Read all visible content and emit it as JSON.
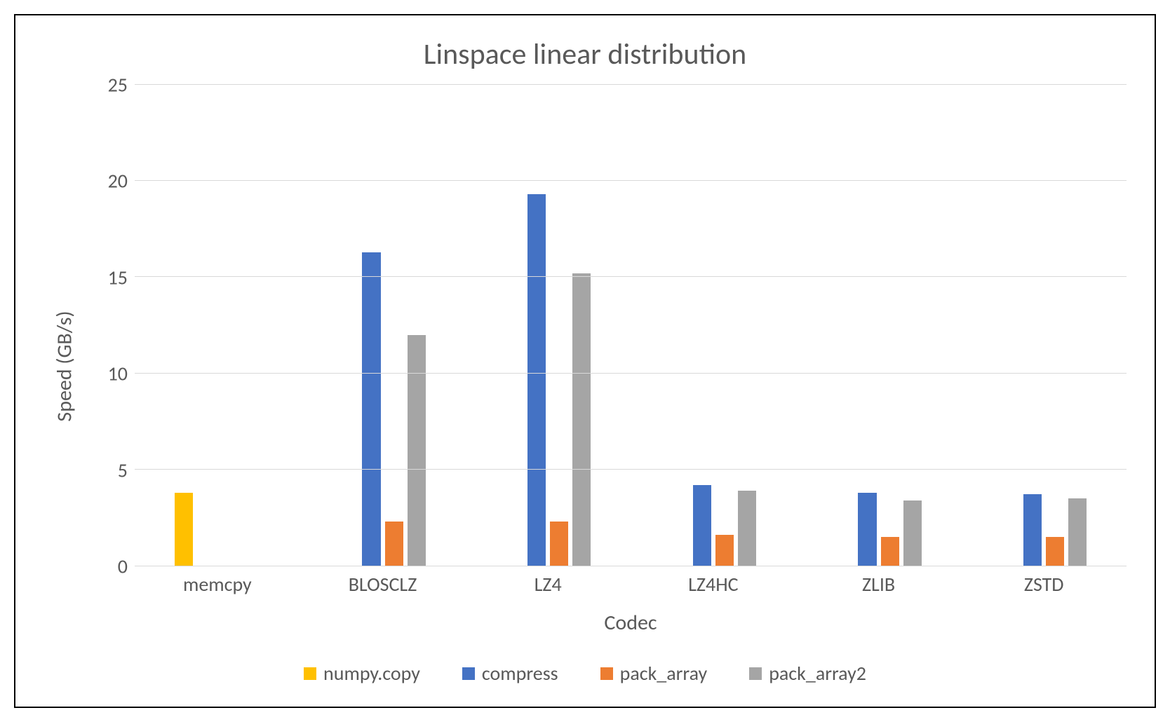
{
  "chart_data": {
    "type": "bar",
    "title": "Linspace linear distribution",
    "xlabel": "Codec",
    "ylabel": "Speed (GB/s)",
    "ylim": [
      0,
      25
    ],
    "yticks": [
      0,
      5,
      10,
      15,
      20,
      25
    ],
    "categories": [
      "memcpy",
      "BLOSCLZ",
      "LZ4",
      "LZ4HC",
      "ZLIB",
      "ZSTD"
    ],
    "series": [
      {
        "name": "numpy.copy",
        "color": "#ffc000",
        "values": [
          3.8,
          null,
          null,
          null,
          null,
          null
        ]
      },
      {
        "name": "compress",
        "color": "#4472c4",
        "values": [
          null,
          16.3,
          19.3,
          4.2,
          3.8,
          3.7
        ]
      },
      {
        "name": "pack_array",
        "color": "#ed7d31",
        "values": [
          null,
          2.3,
          2.3,
          1.6,
          1.5,
          1.5
        ]
      },
      {
        "name": "pack_array2",
        "color": "#a5a5a5",
        "values": [
          null,
          12.0,
          15.2,
          3.9,
          3.4,
          3.5
        ]
      }
    ],
    "legend_position": "bottom",
    "grid": true
  }
}
